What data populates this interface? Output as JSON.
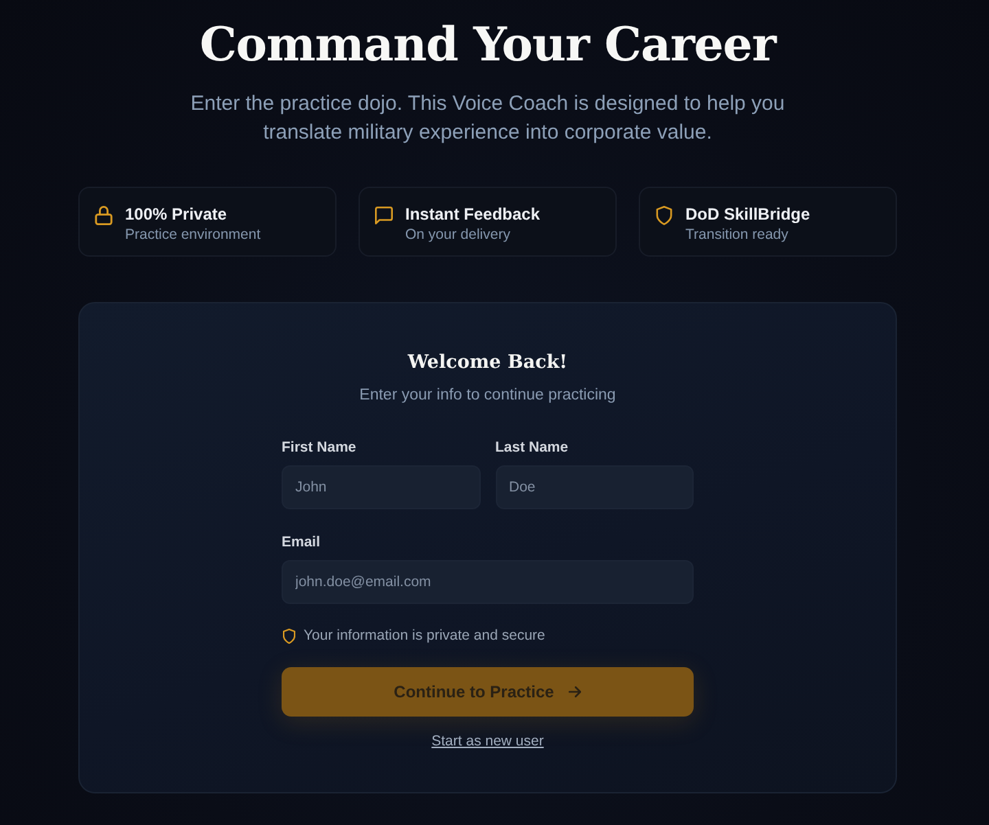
{
  "hero": {
    "title": "Command Your Career",
    "subtitle": "Enter the practice dojo. This Voice Coach is designed to help you translate military experience into corporate value."
  },
  "features": [
    {
      "kind": "lock",
      "title": "100% Private",
      "subtitle": "Practice environment"
    },
    {
      "kind": "message",
      "title": "Instant Feedback",
      "subtitle": "On your delivery"
    },
    {
      "kind": "shield",
      "title": "DoD SkillBridge",
      "subtitle": "Transition ready"
    }
  ],
  "login_card": {
    "title": "Welcome Back!",
    "subtitle": "Enter your info to continue practicing",
    "field_rows": [
      [
        {
          "label": "First Name",
          "placeholder": "John"
        },
        {
          "label": "Last Name",
          "placeholder": "Doe"
        }
      ],
      [
        {
          "label": "Email",
          "placeholder": "john.doe@email.com"
        }
      ]
    ],
    "privacy_note": "Your information is private and secure",
    "submit_button": "Continue to Practice",
    "secondary_link": "Start as new user"
  }
}
